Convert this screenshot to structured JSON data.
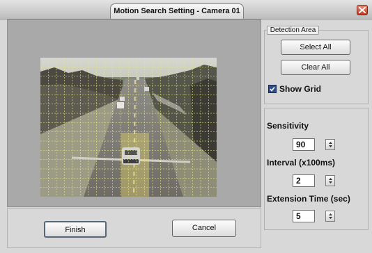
{
  "window": {
    "title": "Motion Search Setting - Camera 01"
  },
  "actions": {
    "finish_label": "Finish",
    "cancel_label": "Cancel"
  },
  "detection_area": {
    "tab_label": "Detection Area",
    "select_all_label": "Select All",
    "clear_all_label": "Clear All",
    "show_grid_label": "Show Grid",
    "show_grid_checked": true
  },
  "settings": {
    "sensitivity": {
      "label": "Sensitivity",
      "value": "90"
    },
    "interval": {
      "label": "Interval (x100ms)",
      "value": "2"
    },
    "extension": {
      "label": "Extension Time (sec)",
      "value": "5"
    }
  },
  "colors": {
    "grid_line": "#e9e97a",
    "selection_fill": "#f2e36a",
    "close_button": "#d2482c"
  }
}
